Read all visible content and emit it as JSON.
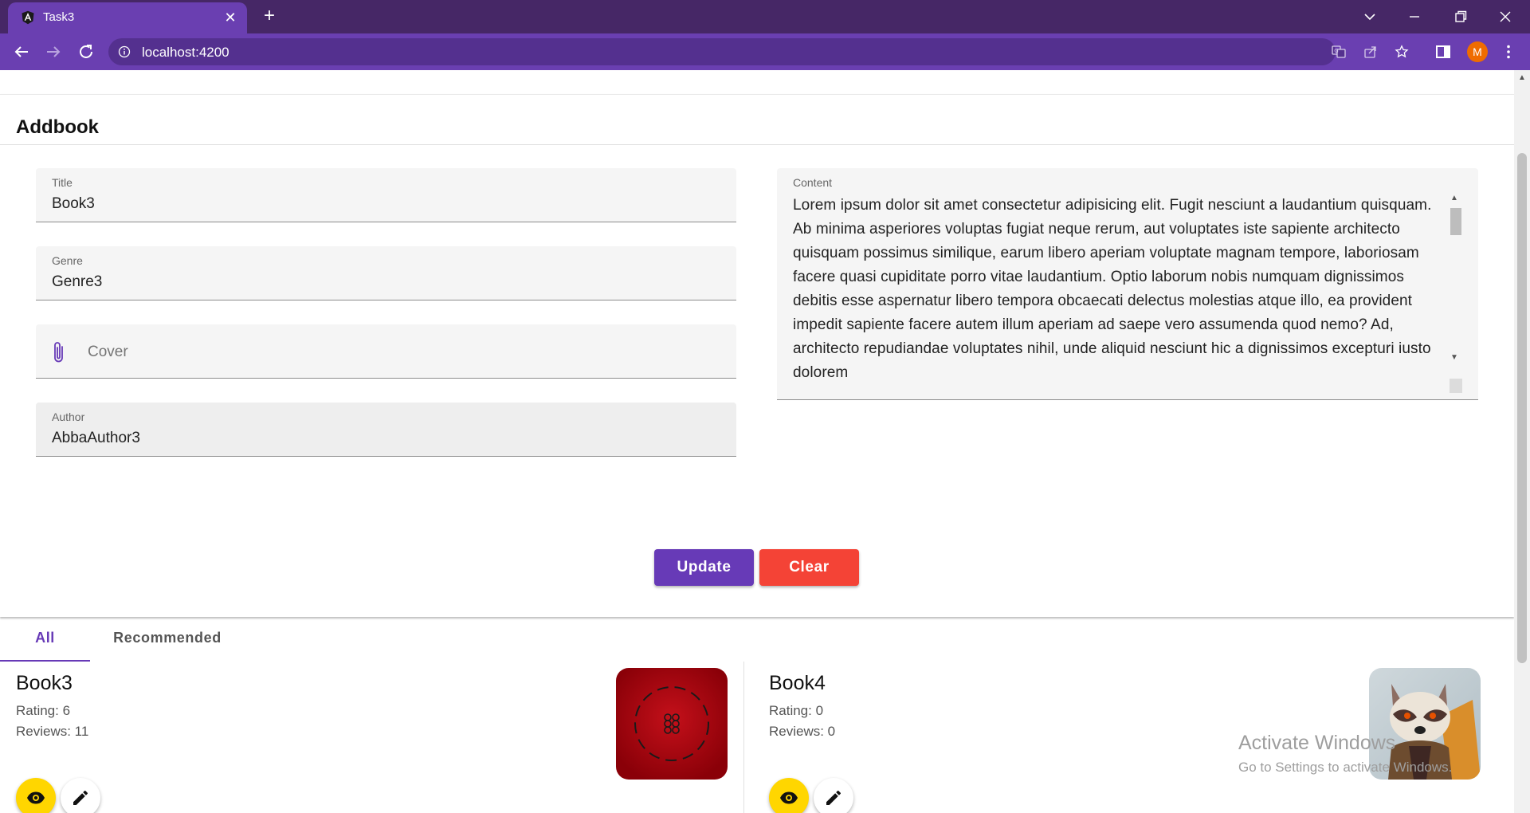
{
  "browser": {
    "tab_title": "Task3",
    "url": "localhost:4200",
    "profile_initial": "M"
  },
  "card": {
    "title": "Addbook"
  },
  "form": {
    "title": {
      "label": "Title",
      "value": "Book3"
    },
    "genre": {
      "label": "Genre",
      "value": "Genre3"
    },
    "cover": {
      "placeholder": "Cover"
    },
    "author": {
      "label": "Author",
      "value": "AbbaAuthor3"
    },
    "content": {
      "label": "Content",
      "value": "Lorem ipsum dolor sit amet consectetur adipisicing elit. Fugit nesciunt a laudantium quisquam. Ab minima asperiores voluptas fugiat neque rerum, aut voluptates iste sapiente architecto quisquam possimus similique, earum libero aperiam voluptate magnam tempore, laboriosam facere quasi cupiditate porro vitae laudantium. Optio laborum nobis numquam dignissimos debitis esse aspernatur libero tempora obcaecati delectus molestias atque illo, ea provident impedit sapiente facere autem illum aperiam ad saepe vero assumenda quod nemo? Ad, architecto repudiandae voluptates nihil, unde aliquid nesciunt hic a dignissimos excepturi iusto dolorem"
    },
    "update_label": "Update",
    "clear_label": "Clear"
  },
  "tabs": {
    "all": "All",
    "recommended": "Recommended"
  },
  "books": [
    {
      "title": "Book3",
      "rating": "Rating: 6",
      "reviews": "Reviews: 11"
    },
    {
      "title": "Book4",
      "rating": "Rating: 0",
      "reviews": "Reviews: 0"
    }
  ],
  "watermark": {
    "line1": "Activate Windows",
    "line2": "Go to Settings to activate Windows."
  },
  "colors": {
    "primary": "#673ab7",
    "warn": "#f44336",
    "accent": "#ffd600",
    "chrome_frame": "#462766",
    "chrome_toolbar": "#6a3fb1"
  }
}
